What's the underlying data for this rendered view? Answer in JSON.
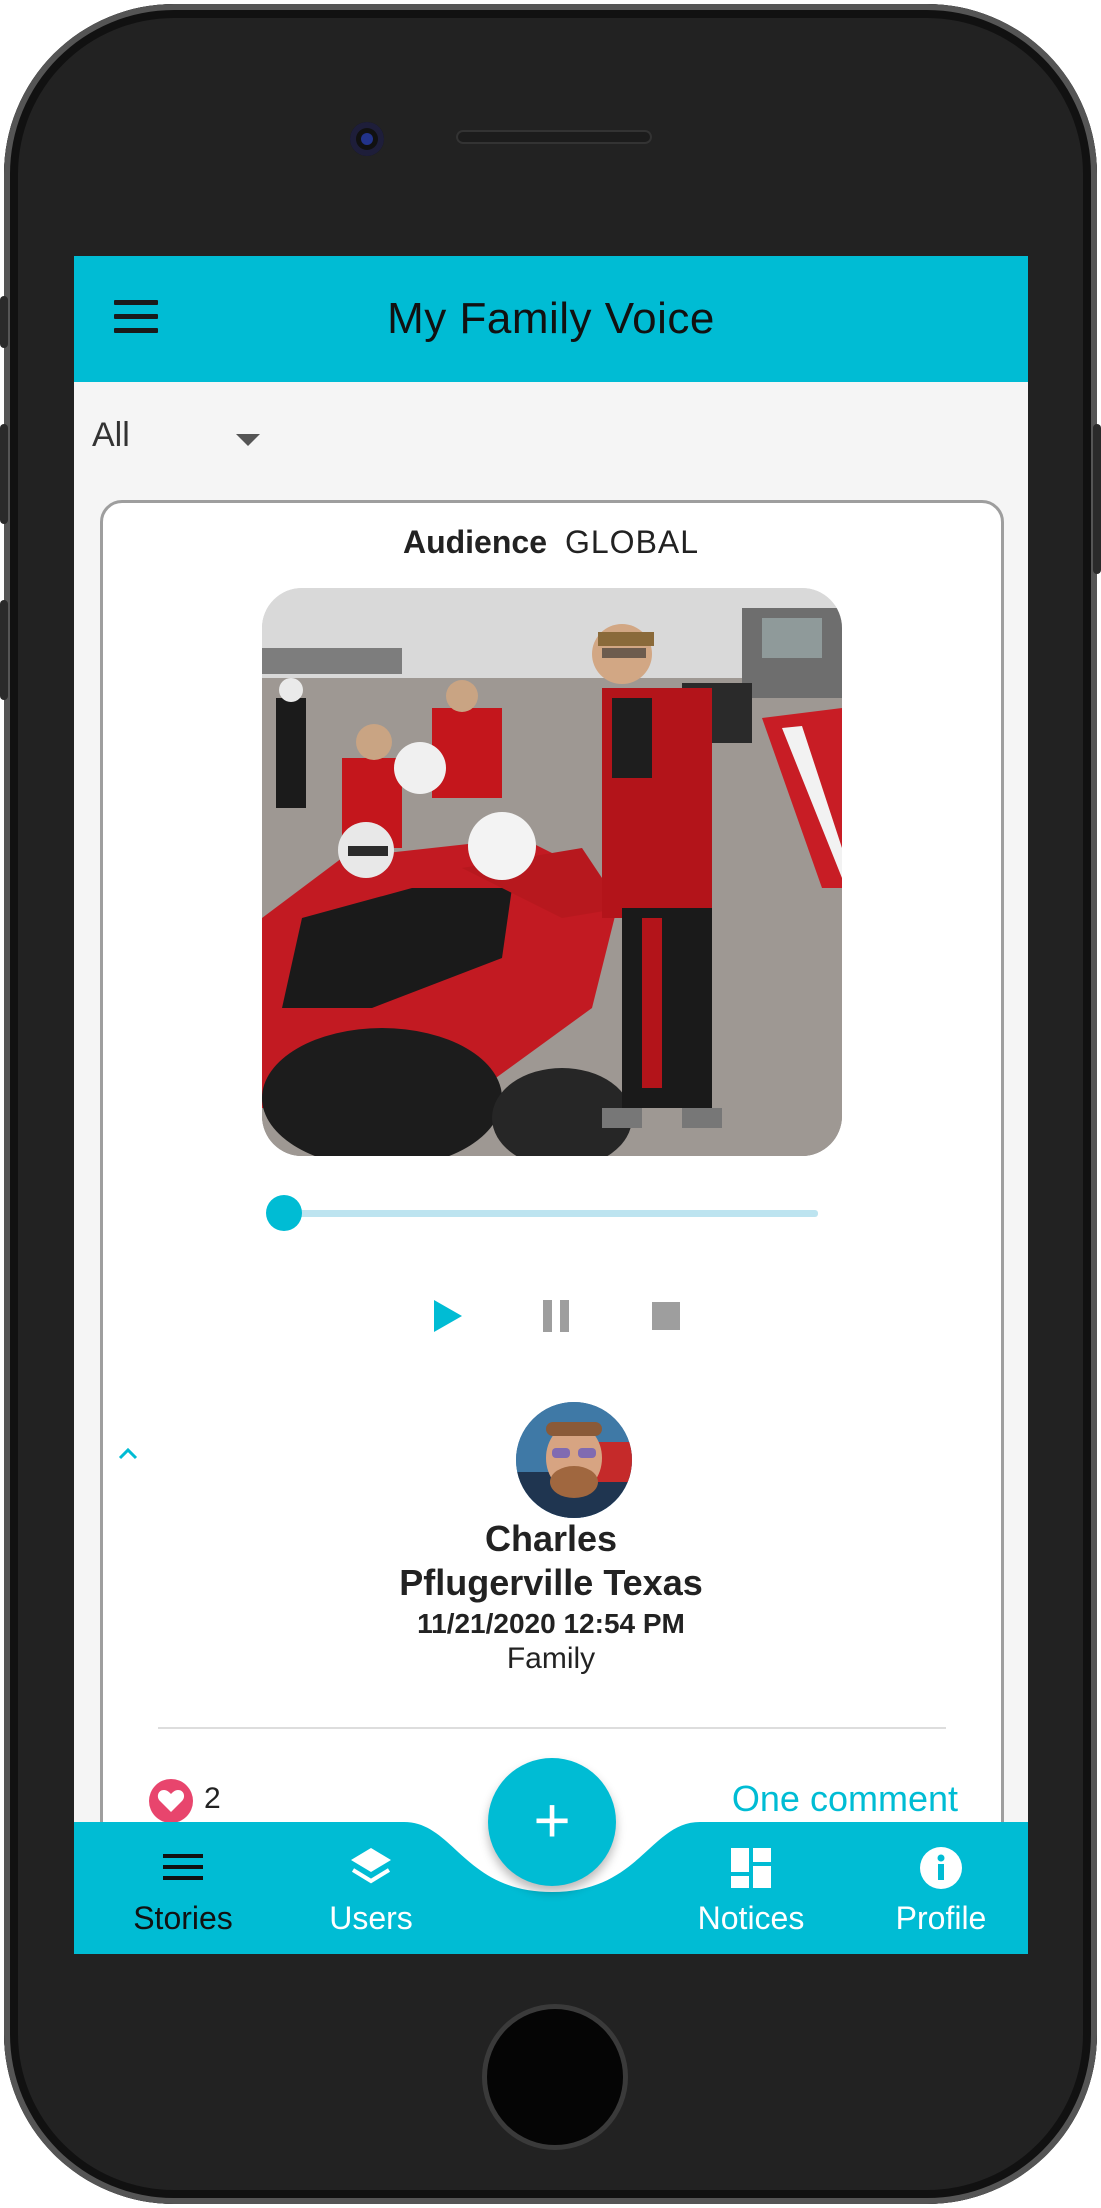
{
  "app": {
    "title": "My Family Voice"
  },
  "filter": {
    "selected": "All"
  },
  "story": {
    "audience_label": "Audience",
    "audience_value": "GLOBAL",
    "playback_progress": 0.0,
    "author": {
      "name": "Charles",
      "location": "Pflugerville Texas",
      "datetime": "11/21/2020 12:54 PM",
      "group": "Family"
    },
    "likes_count": "2",
    "comments_label": "One comment"
  },
  "controls": {
    "play": "play-icon",
    "pause": "pause-icon",
    "stop": "stop-icon"
  },
  "fab": {
    "label": "+"
  },
  "bottom_nav": {
    "stories": "Stories",
    "users": "Users",
    "notices": "Notices",
    "profile": "Profile"
  },
  "colors": {
    "accent": "#00bcd4",
    "like": "#e8456d",
    "background": "#f5f5f5"
  }
}
